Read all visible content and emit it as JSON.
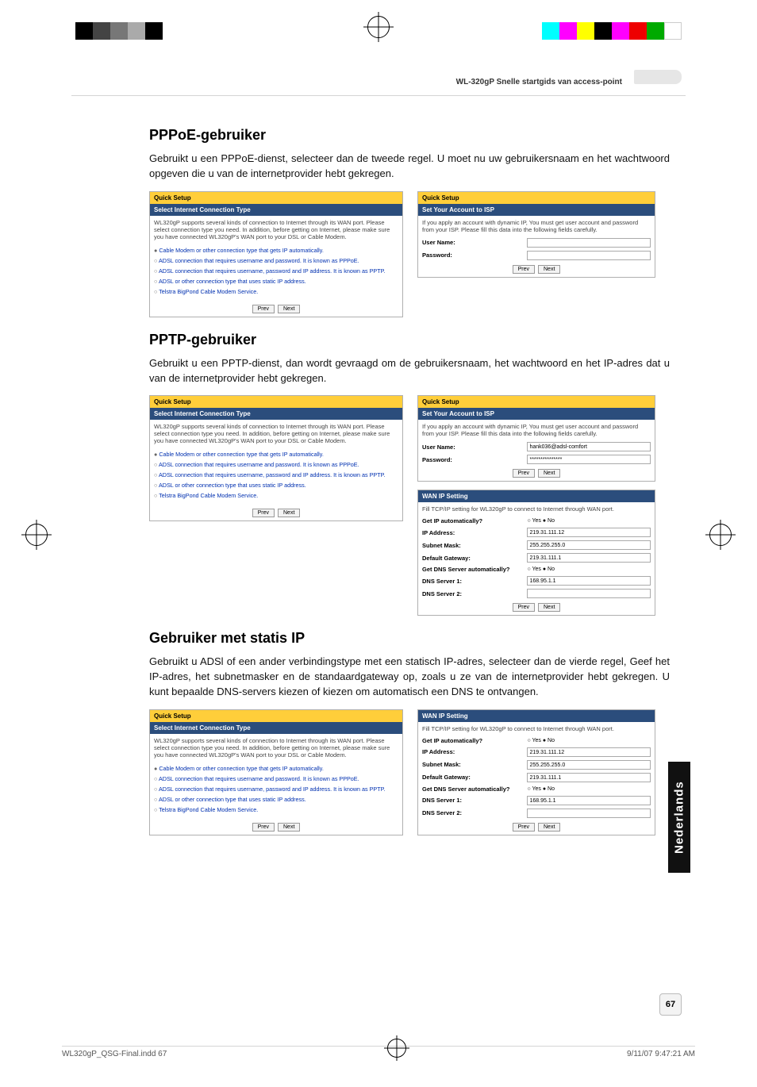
{
  "header": {
    "product_label": "WL-320gP Snelle startgids van access-point"
  },
  "sections": {
    "pppoe": {
      "title": "PPPoE-gebruiker",
      "intro": "Gebruikt u een PPPoE-dienst, selecteer dan de tweede regel. U moet nu uw gebruikersnaam en het wachtwoord opgeven die u van de internetprovider hebt gekregen."
    },
    "pptp": {
      "title": "PPTP-gebruiker",
      "intro": "Gebruikt u een PPTP-dienst, dan wordt gevraagd om de gebruikersnaam, het wachtwoord en het IP-adres dat u van de internetprovider hebt gekregen."
    },
    "static": {
      "title": "Gebruiker met statis IP",
      "intro": "Gebruikt u ADSl of een ander verbindingstype met een statisch IP-adres, selecteer dan de vierde regel, Geef het IP-adres, het subnetmasker en de standaardgateway op, zoals u ze van de internetprovider hebt gekregen. U kunt bepaalde DNS-servers kiezen of kiezen om automatisch een DNS te ontvangen."
    }
  },
  "router_ui": {
    "quick_setup": "Quick Setup",
    "select_type": "Select Internet Connection Type",
    "type_desc": "WL320gP supports several kinds of connection to Internet through its WAN port. Please select connection type you need. In addition, before getting on Internet, please make sure you have connected WL320gP's WAN port to your DSL or Cable Modem.",
    "opts": {
      "auto": "Cable Modem or other connection type that gets IP automatically.",
      "pppoe": "ADSL connection that requires username and password. It is known as PPPoE.",
      "pptp": "ADSL connection that requires username, password and IP address. It is known as PPTP.",
      "static": "ADSL or other connection type that uses static IP address.",
      "bigpond": "Telstra BigPond Cable Modem Service."
    },
    "btn_prev": "Prev",
    "btn_next": "Next",
    "set_account": "Set Your Account to ISP",
    "account_desc": "If you apply an account with dynamic IP, You must get user account and password from your ISP. Please fill this data into the following fields carefully.",
    "username_label": "User Name:",
    "password_label": "Password:",
    "username_val": "hank036@adsl-comfort",
    "password_val": "***************",
    "wan_ip": "WAN IP Setting",
    "wan_desc": "Fill TCP/IP setting for WL320gP to connect to Internet through WAN port.",
    "get_ip": "Get IP automatically?",
    "ip_addr": "IP Address:",
    "subnet": "Subnet Mask:",
    "gateway": "Default Gateway:",
    "get_dns": "Get DNS Server automatically?",
    "dns1": "DNS Server 1:",
    "dns2": "DNS Server 2:",
    "vals": {
      "ip": "219.31.111.12",
      "mask": "255.255.255.0",
      "gw": "219.31.111.1",
      "dns1": "168.95.1.1",
      "dns2": ""
    },
    "yesno": "○ Yes  ● No"
  },
  "side_tab": "Nederlands",
  "page_number": "67",
  "footer": {
    "file": "WL320gP_QSG-Final.indd   67",
    "stamp": "9/11/07   9:47:21 AM"
  }
}
